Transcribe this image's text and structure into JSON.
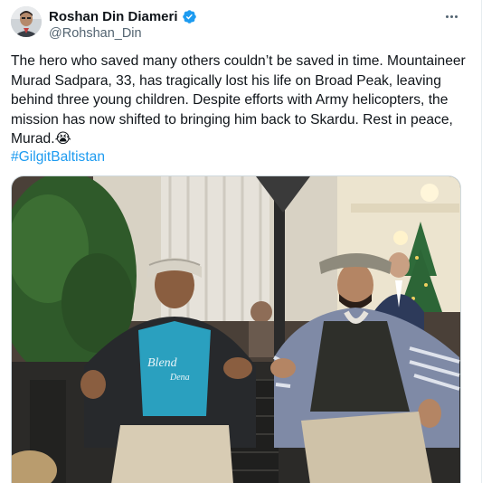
{
  "tweet": {
    "author": {
      "name": "Roshan Din Diameri",
      "handle": "@Rohshan_Din",
      "verified": true
    },
    "text": "The hero who saved many others couldn’t be saved in time. Mountaineer Murad Sadpara, 33, has tragically lost his life on Broad Peak, leaving behind three young children. Despite efforts with Army helicopters, the mission has now shifted to bringing him back to Skardu. Rest in peace, Murad.😭",
    "hashtag": "#GilgitBaltistan",
    "photo": {
      "shirt_text": "Blend",
      "shirt_text2": "Dena"
    }
  },
  "icons": {
    "verified": "verified-badge-icon",
    "more": "more-options-icon"
  },
  "colors": {
    "link": "#1d9bf0",
    "secondary_text": "#536471",
    "verified": "#1d9bf0"
  }
}
